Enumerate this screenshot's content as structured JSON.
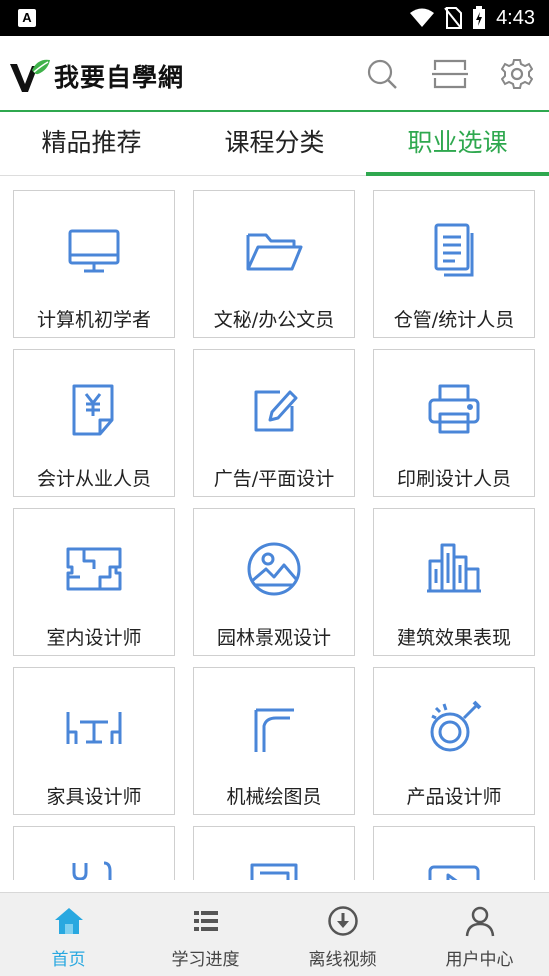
{
  "status_bar": {
    "app_icon_letter": "A",
    "time": "4:43"
  },
  "header": {
    "logo_text": "我要自學網",
    "icons": [
      "search-icon",
      "scan-icon",
      "settings-icon"
    ]
  },
  "tabs": [
    {
      "label": "精品推荐",
      "active": false
    },
    {
      "label": "课程分类",
      "active": false
    },
    {
      "label": "职业选课",
      "active": true
    }
  ],
  "grid": {
    "items": [
      {
        "label": "计算机初学者",
        "icon": "monitor-icon"
      },
      {
        "label": "文秘/办公文员",
        "icon": "folder-icon"
      },
      {
        "label": "仓管/统计人员",
        "icon": "document-icon"
      },
      {
        "label": "会计从业人员",
        "icon": "yuan-receipt-icon"
      },
      {
        "label": "广告/平面设计",
        "icon": "edit-icon"
      },
      {
        "label": "印刷设计人员",
        "icon": "printer-icon"
      },
      {
        "label": "室内设计师",
        "icon": "floorplan-icon"
      },
      {
        "label": "园林景观设计",
        "icon": "landscape-icon"
      },
      {
        "label": "建筑效果表现",
        "icon": "buildings-icon"
      },
      {
        "label": "家具设计师",
        "icon": "table-chairs-icon"
      },
      {
        "label": "机械绘图员",
        "icon": "drafting-ruler-icon"
      },
      {
        "label": "产品设计师",
        "icon": "product-design-icon"
      },
      {
        "label": "",
        "icon": "tools-icon"
      },
      {
        "label": "",
        "icon": "frame-icon"
      },
      {
        "label": "",
        "icon": "video-icon"
      }
    ]
  },
  "bottom_nav": [
    {
      "label": "首页",
      "icon": "home-icon",
      "active": true
    },
    {
      "label": "学习进度",
      "icon": "list-icon",
      "active": false
    },
    {
      "label": "离线视频",
      "icon": "download-icon",
      "active": false
    },
    {
      "label": "用户中心",
      "icon": "user-icon",
      "active": false
    }
  ],
  "colors": {
    "accent_green": "#2fa84f",
    "icon_blue": "#4a86d8",
    "nav_active": "#29a8e0"
  }
}
